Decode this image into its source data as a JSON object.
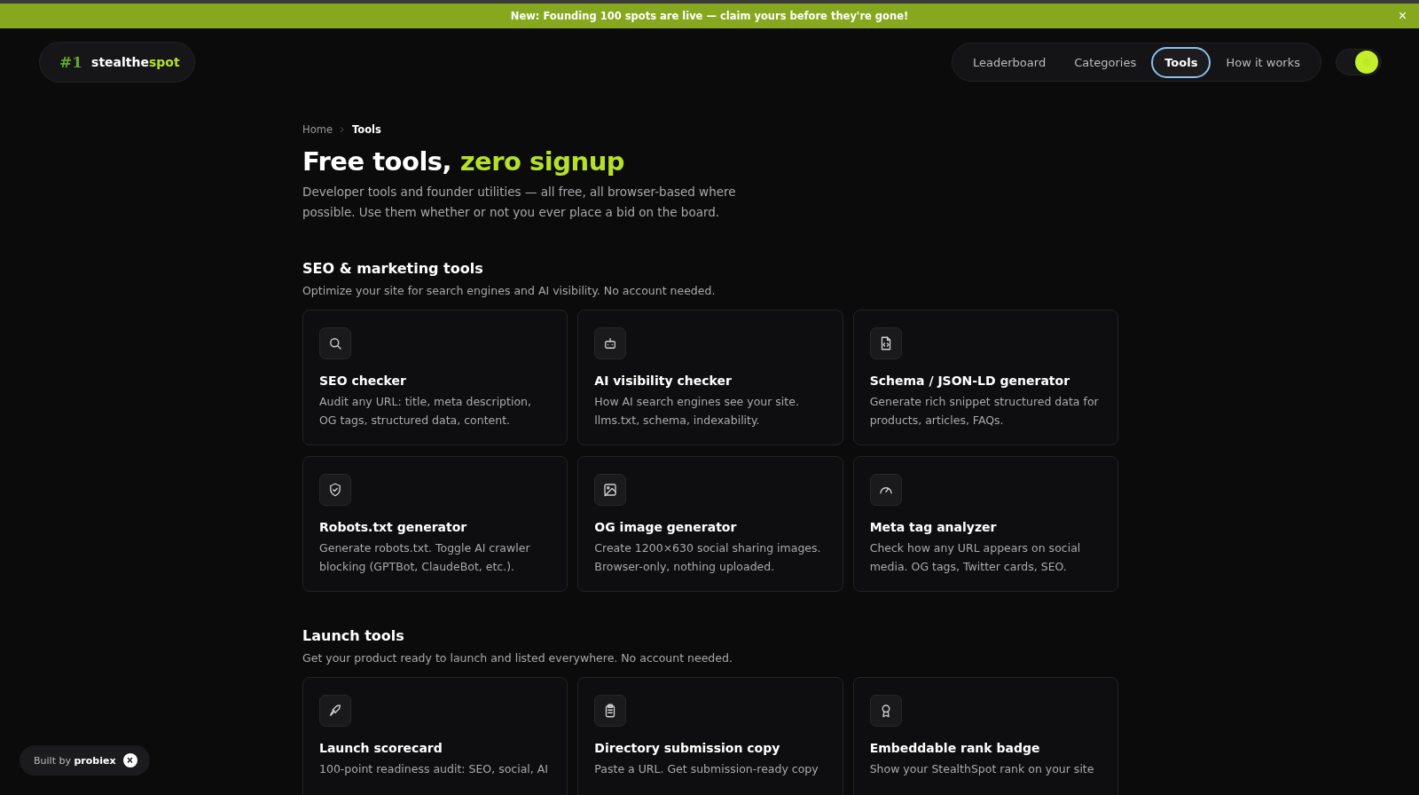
{
  "banner": {
    "text": "New: Founding 100 spots are live — claim yours before they're gone!",
    "close": "×"
  },
  "logo": {
    "mark": "#1",
    "name": "stealthe",
    "accent": "spot"
  },
  "nav": [
    {
      "label": "Leaderboard",
      "selected": false
    },
    {
      "label": "Categories",
      "selected": false
    },
    {
      "label": "Tools",
      "selected": true
    },
    {
      "label": "How it works",
      "selected": false
    }
  ],
  "theme_toggle": {
    "on": true
  },
  "breadcrumb": [
    "Home",
    "Tools"
  ],
  "heading": {
    "text": "Free tools, ",
    "accent": "zero signup"
  },
  "intro": "Developer tools and founder utilities — all free, all browser-based where possible. Use them whether or not you ever place a bid on the board.",
  "sections": [
    {
      "title": "SEO & marketing tools",
      "subtitle": "Optimize your site for search engines and AI visibility. No account needed.",
      "cards": [
        {
          "kind": "search",
          "title": "SEO checker",
          "text": "Audit any URL: title, meta description, OG tags, structured data, content."
        },
        {
          "kind": "robot",
          "title": "AI visibility checker",
          "text": "How AI search engines see your site. llms.txt, schema, indexability."
        },
        {
          "kind": "code",
          "title": "Schema / JSON-LD generator",
          "text": "Generate rich snippet structured data for products, articles, FAQs."
        },
        {
          "kind": "shield",
          "title": "Robots.txt generator",
          "text": "Generate robots.txt. Toggle AI crawler blocking (GPTBot, ClaudeBot, etc.)."
        },
        {
          "kind": "image",
          "title": "OG image generator",
          "text": "Create 1200×630 social sharing images. Browser-only, nothing uploaded."
        },
        {
          "kind": "gauge",
          "title": "Meta tag analyzer",
          "text": "Check how any URL appears on social media. OG tags, Twitter cards, SEO."
        }
      ]
    },
    {
      "title": "Launch tools",
      "subtitle": "Get your product ready to launch and listed everywhere. No account needed.",
      "cards": [
        {
          "kind": "rocket",
          "title": "Launch scorecard",
          "text": "100-point readiness audit: SEO, social, AI"
        },
        {
          "kind": "clipboard",
          "title": "Directory submission copy",
          "text": "Paste a URL. Get submission-ready copy"
        },
        {
          "kind": "award",
          "title": "Embeddable rank badge",
          "text": "Show your StealthSpot rank on your site"
        }
      ]
    }
  ],
  "built_by": {
    "label": "Built by ",
    "name": "probiex",
    "close": "×"
  }
}
